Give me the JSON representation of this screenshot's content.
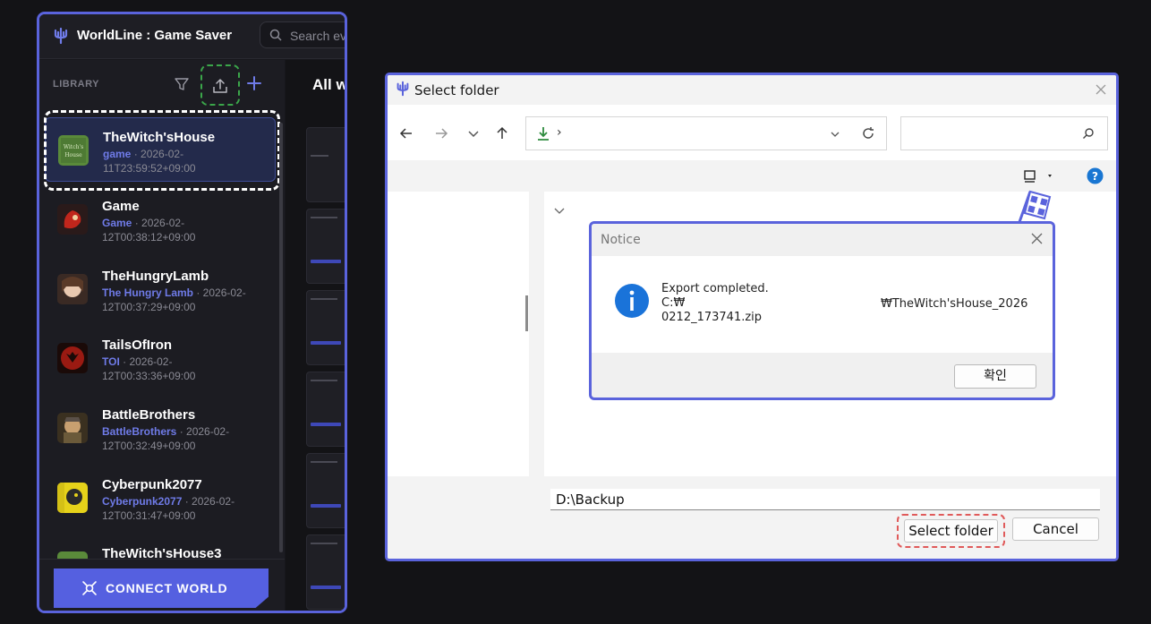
{
  "app": {
    "title": "WorldLine : Game Saver",
    "search_placeholder": "Search ev",
    "library_label": "LIBRARY",
    "main_title": "All w",
    "connect_label": "CONNECT WORLD",
    "accent_color": "#5a63dc",
    "icons": [
      "app-logo-icon",
      "search-icon",
      "filter-icon",
      "export-icon",
      "add-icon",
      "connect-icon"
    ]
  },
  "games": [
    {
      "name": "TheWitch'sHouse",
      "alias": "game",
      "date": " · 2026-02-11T23:59:52+09:00",
      "thumb_color": "#5a8a3a"
    },
    {
      "name": "Game",
      "alias": "Game",
      "date": " · 2026-02-12T00:38:12+09:00",
      "thumb_color": "#a0271e"
    },
    {
      "name": "TheHungryLamb",
      "alias": "The Hungry Lamb",
      "date": " · 2026-02-12T00:37:29+09:00",
      "thumb_color": "#7a4a3a"
    },
    {
      "name": "TailsOfIron",
      "alias": "TOI",
      "date": " · 2026-02-12T00:33:36+09:00",
      "thumb_color": "#8a1a14"
    },
    {
      "name": "BattleBrothers",
      "alias": "BattleBrothers",
      "date": " · 2026-02-12T00:32:49+09:00",
      "thumb_color": "#6b5a3a"
    },
    {
      "name": "Cyberpunk2077",
      "alias": "Cyberpunk2077",
      "date": " · 2026-02-12T00:31:47+09:00",
      "thumb_color": "#e6d21a"
    },
    {
      "name": "TheWitch'sHouse3",
      "alias": "",
      "date": "",
      "thumb_color": "#5a8a3a"
    }
  ],
  "dialog": {
    "title": "Select folder",
    "folder_value": "D:\\Backup",
    "select_label": "Select folder",
    "cancel_label": "Cancel"
  },
  "notice": {
    "title": "Notice",
    "line1": "Export completed.",
    "line2": "C:₩",
    "line3": "0212_173741.zip",
    "path_right": "₩TheWitch'sHouse_2026",
    "ok_label": "확인"
  }
}
